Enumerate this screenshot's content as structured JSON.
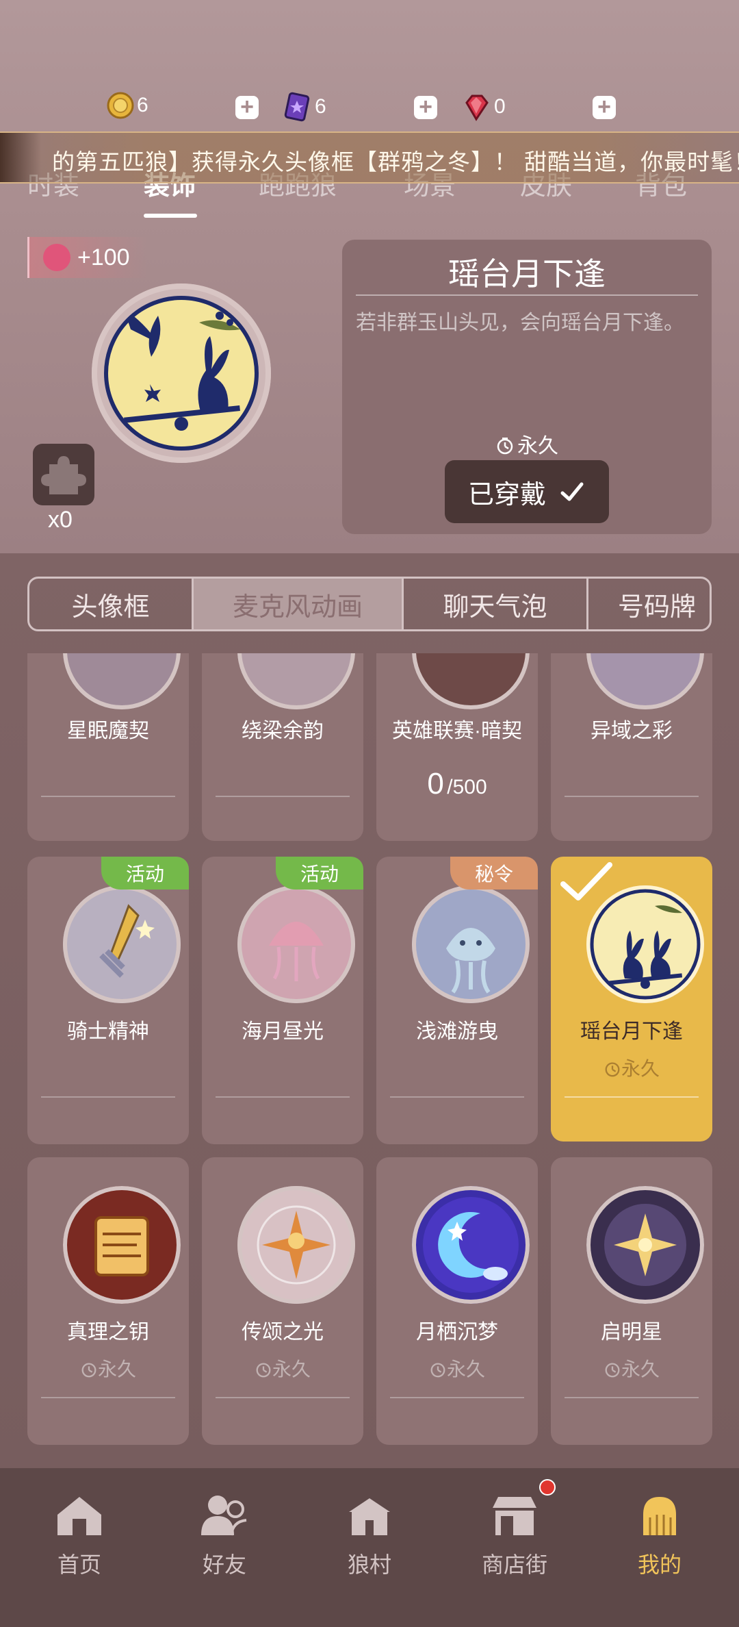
{
  "currency": [
    {
      "icon": "coin-icon",
      "value": "6"
    },
    {
      "icon": "purple-card-icon",
      "value": "6"
    },
    {
      "icon": "red-gem-icon",
      "value": "0"
    }
  ],
  "marquee": {
    "text": "的第五匹狼】获得永久头像框【群鸦之冬】！ 甜酷当道，你最时髦！"
  },
  "category_tabs": [
    {
      "label": "时装",
      "active": false
    },
    {
      "label": "装饰",
      "active": true
    },
    {
      "label": "跑跑狼",
      "active": false
    },
    {
      "label": "场景",
      "active": false
    },
    {
      "label": "皮肤",
      "active": false
    },
    {
      "label": "背包",
      "active": false
    }
  ],
  "preview": {
    "score": "+100",
    "puzzle_count": "x0",
    "title": "瑶台月下逢",
    "description": "若非群玉山头见，会向瑶台月下逢。",
    "duration": "永久",
    "wear_label": "已穿戴"
  },
  "sub_tabs": [
    {
      "label": "头像框",
      "active": false
    },
    {
      "label": "麦克风动画",
      "active": true
    },
    {
      "label": "聊天气泡",
      "active": false
    },
    {
      "label": "号码牌",
      "active": false
    }
  ],
  "items_row1": [
    {
      "name": "星眠魔契"
    },
    {
      "name": "绕梁余韵"
    },
    {
      "name": "英雄联赛·暗契",
      "progress": "0",
      "progress_max": "/500"
    },
    {
      "name": "异域之彩"
    }
  ],
  "items_row2": [
    {
      "name": "骑士精神",
      "tag": "活动"
    },
    {
      "name": "海月昼光",
      "tag": "活动"
    },
    {
      "name": "浅滩游曳",
      "tag": "秘令"
    },
    {
      "name": "瑶台月下逢",
      "duration": "永久",
      "selected": true
    }
  ],
  "items_row3": [
    {
      "name": "真理之钥",
      "duration": "永久"
    },
    {
      "name": "传颂之光",
      "duration": "永久"
    },
    {
      "name": "月栖沉梦",
      "duration": "永久"
    },
    {
      "name": "启明星",
      "duration": "永久"
    }
  ],
  "bottom_nav": [
    {
      "label": "首页",
      "icon": "home-icon"
    },
    {
      "label": "好友",
      "icon": "friends-icon"
    },
    {
      "label": "狼村",
      "icon": "village-icon"
    },
    {
      "label": "商店街",
      "icon": "shop-icon",
      "badge": true
    },
    {
      "label": "我的",
      "icon": "profile-icon",
      "active": true
    }
  ],
  "colors": {
    "accent": "#e8b94a",
    "active_nav": "#f1c45a",
    "tag_green": "#74b94a",
    "tag_orange": "#d9956b"
  }
}
